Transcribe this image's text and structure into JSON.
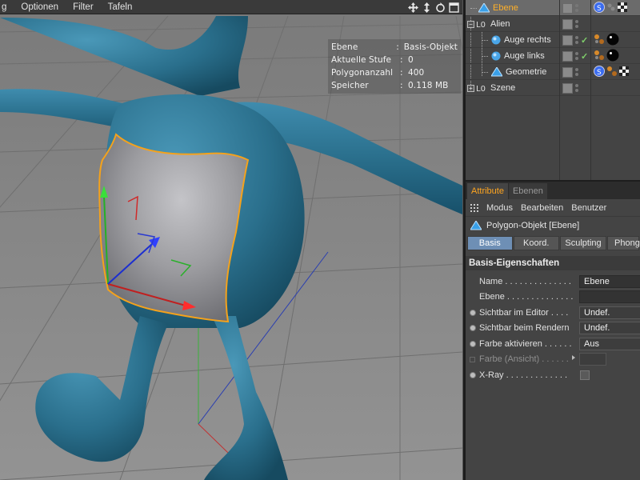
{
  "viewport": {
    "menu": [
      "g",
      "Optionen",
      "Filter",
      "Tafeln"
    ],
    "nav_icons": [
      "move-view-icon",
      "pan-view-icon",
      "rotate-view-icon",
      "maximize-view-icon"
    ],
    "hud": [
      {
        "key": "Ebene",
        "value": "Basis-Objekt"
      },
      {
        "key": "Aktuelle Stufe",
        "value": "0"
      },
      {
        "key": "Polygonanzahl",
        "value": "400"
      },
      {
        "key": "Speicher",
        "value": "0.118 MB"
      }
    ],
    "colors": {
      "alien": "#2a6f8c",
      "selection": "#f4a21c",
      "grid_floor": "#8d8d8d",
      "cloth": "#a4a4a8"
    }
  },
  "object_manager": {
    "rows": [
      {
        "name": "Ebene",
        "selected": true,
        "active": true,
        "icon": "plane-icon",
        "tags": [
          "sculpt-tag-icon",
          "dots-icon",
          "checker-texture-icon"
        ]
      },
      {
        "name": "Alien",
        "icon": "null-icon",
        "expanded": true,
        "tags": []
      },
      {
        "name": "Auge rechts",
        "icon": "sphere-icon",
        "check": "✓",
        "tags": [
          "material-dots-icon",
          "black-material-icon"
        ]
      },
      {
        "name": "Auge links",
        "icon": "sphere-icon",
        "check": "✓",
        "tags": [
          "material-dots-icon",
          "black-material-icon"
        ]
      },
      {
        "name": "Geometrie",
        "icon": "plane-icon",
        "tags": [
          "sculpt-tag-icon",
          "material-dots-icon",
          "checker-texture-icon"
        ]
      },
      {
        "name": "Szene",
        "icon": "null-icon",
        "expanded": false,
        "tags": []
      }
    ]
  },
  "attributes": {
    "tabs": [
      "Attribute",
      "Ebenen"
    ],
    "menu": [
      "Modus",
      "Bearbeiten",
      "Benutzer"
    ],
    "header": "Polygon-Objekt [Ebene]",
    "subtabs": [
      "Basis",
      "Koord.",
      "Sculpting",
      "Phong"
    ],
    "group_title": "Basis-Eigenschaften",
    "props": [
      {
        "label": "Name . . . . . . . . . . . . . .",
        "value": "Ebene",
        "radio": false
      },
      {
        "label": "Ebene . . . . . . . . . . . . . .",
        "value": "",
        "radio": false
      },
      {
        "label": "Sichtbar im Editor . . . .",
        "value": "Undef.",
        "radio": true
      },
      {
        "label": "Sichtbar beim Rendern",
        "value": "Undef.",
        "radio": true
      },
      {
        "label": "Farbe aktivieren . . . . . .",
        "value": "Aus",
        "radio": true
      },
      {
        "label": "Farbe (Ansicht) . . . . . .",
        "value": "",
        "radio": false
      },
      {
        "label": "X-Ray . . . . . . . . . . . . .",
        "value": "",
        "radio": true
      }
    ]
  }
}
